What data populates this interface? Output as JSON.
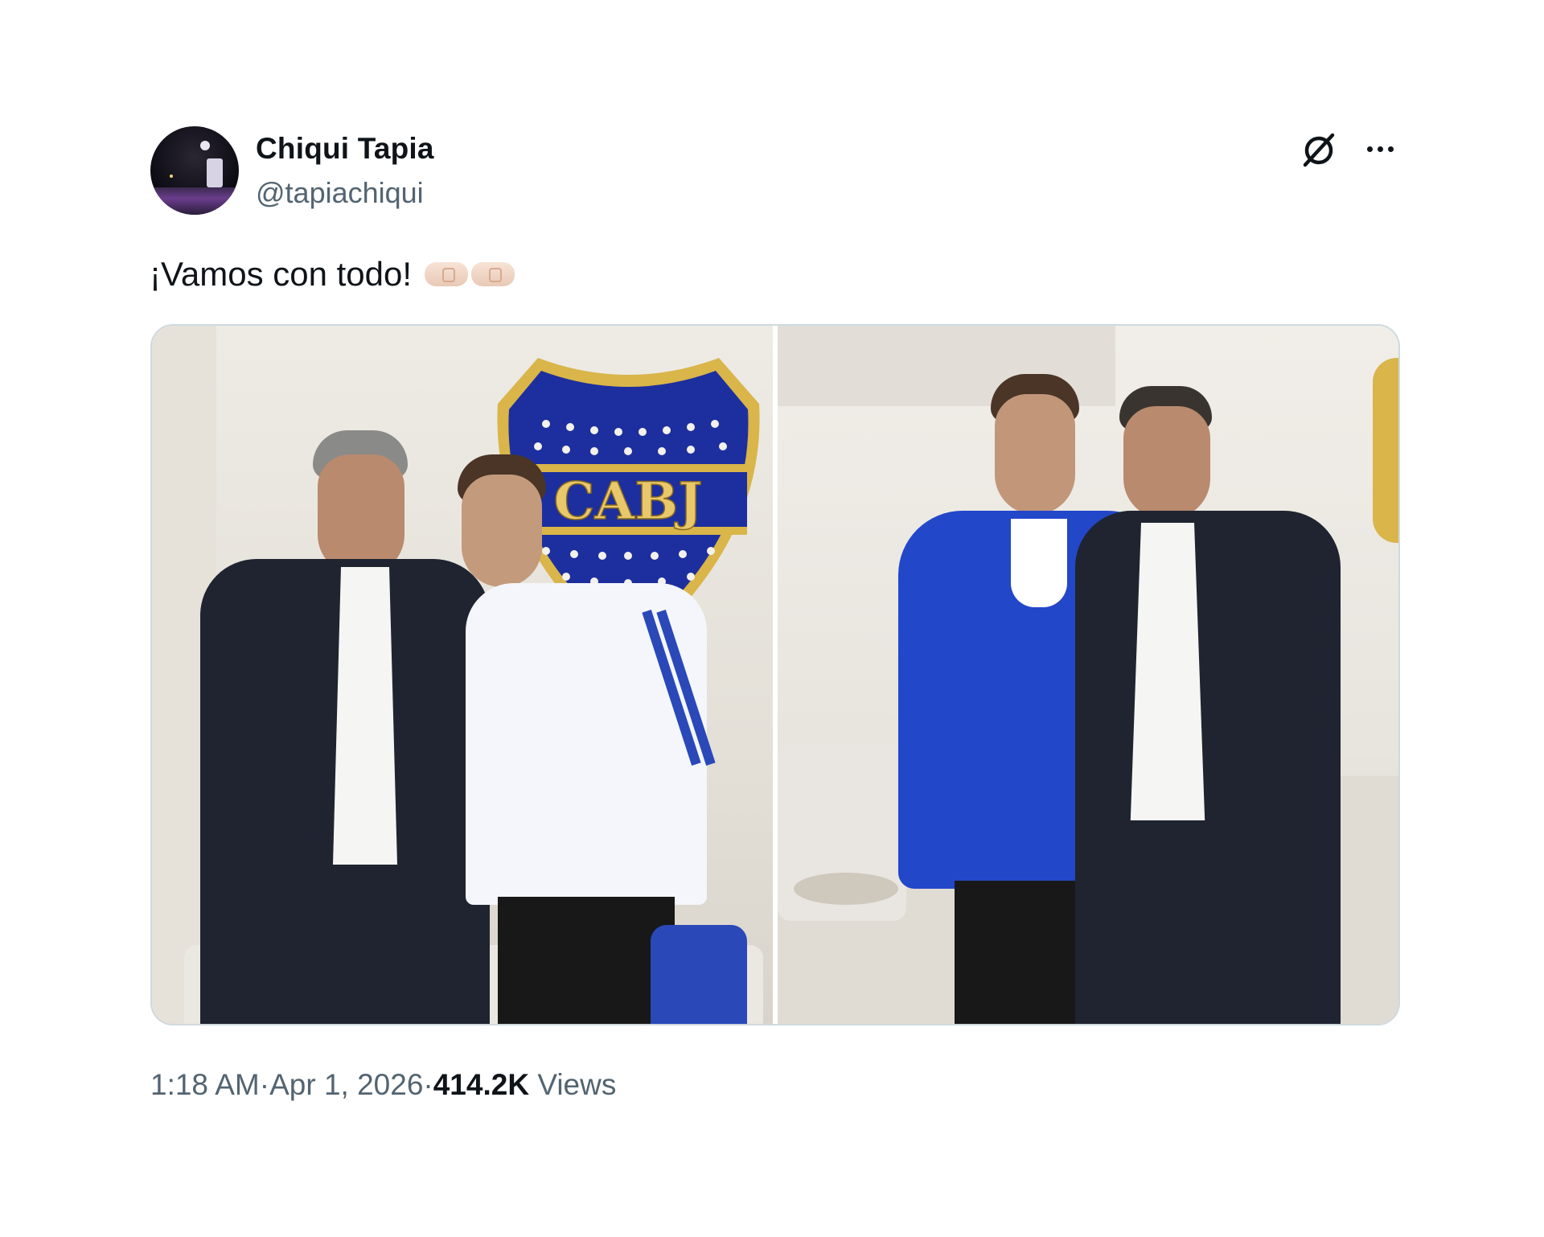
{
  "author": {
    "display_name": "Chiqui Tapia",
    "handle": "@tapiachiqui"
  },
  "header_actions": {
    "grok_icon": "grok-icon",
    "more_icon": "more-icon"
  },
  "tweet": {
    "text": "¡Vamos con todo!",
    "emoji": "fist-bump-emoji"
  },
  "media": {
    "photo_count": 2
  },
  "meta": {
    "time": "1:18 AM",
    "separator": " · ",
    "date": "Apr 1, 2026",
    "views_count": "414.2K",
    "views_label": "Views"
  },
  "colors": {
    "text_primary": "#0f1419",
    "text_secondary": "#536471",
    "border": "#cfd9de",
    "crest_blue": "#1d2f9e",
    "crest_gold": "#d9b54a"
  }
}
